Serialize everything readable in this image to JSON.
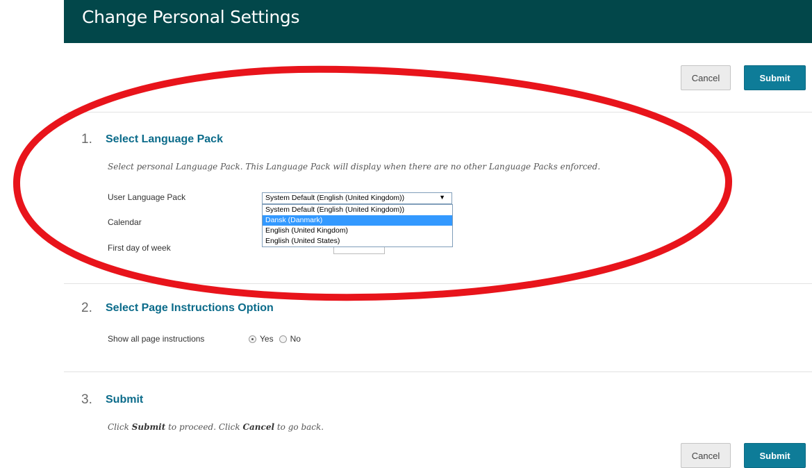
{
  "header": {
    "title": "Change Personal Settings"
  },
  "top_actions": {
    "cancel_label": "Cancel",
    "submit_label": "Submit"
  },
  "sections": [
    {
      "number": "1.",
      "title": "Select Language Pack",
      "instructions": "Select personal Language Pack. This Language Pack will display when there are no other Language Packs enforced.",
      "fields": {
        "language_pack_label": "User Language Pack",
        "calendar_label": "Calendar",
        "first_day_label": "First day of week"
      },
      "language_select": {
        "selected_value": "System Default (English (United Kingdom))",
        "arrow": "▼",
        "options": [
          "System Default (English (United Kingdom))",
          "Dansk (Danmark)",
          "English (United Kingdom)",
          "English (United States)"
        ],
        "highlighted_option": "Dansk (Danmark)"
      }
    },
    {
      "number": "2.",
      "title": "Select Page Instructions Option",
      "fields": {
        "show_instructions_label": "Show all page instructions",
        "yes_label": "Yes",
        "no_label": "No",
        "selected": "Yes"
      }
    },
    {
      "number": "3.",
      "title": "Submit",
      "instructions": {
        "part1": "Click ",
        "submit_word": "Submit",
        "part2": " to proceed. Click ",
        "cancel_word": "Cancel",
        "part3": " to go back."
      }
    }
  ],
  "bottom_actions": {
    "cancel_label": "Cancel",
    "submit_label": "Submit"
  },
  "colors": {
    "header_bg": "#02474a",
    "submit_bg": "#0e7c98",
    "step_title": "#0b6b8a",
    "highlight": "#3399ff",
    "annotation_red": "#e8141b"
  }
}
